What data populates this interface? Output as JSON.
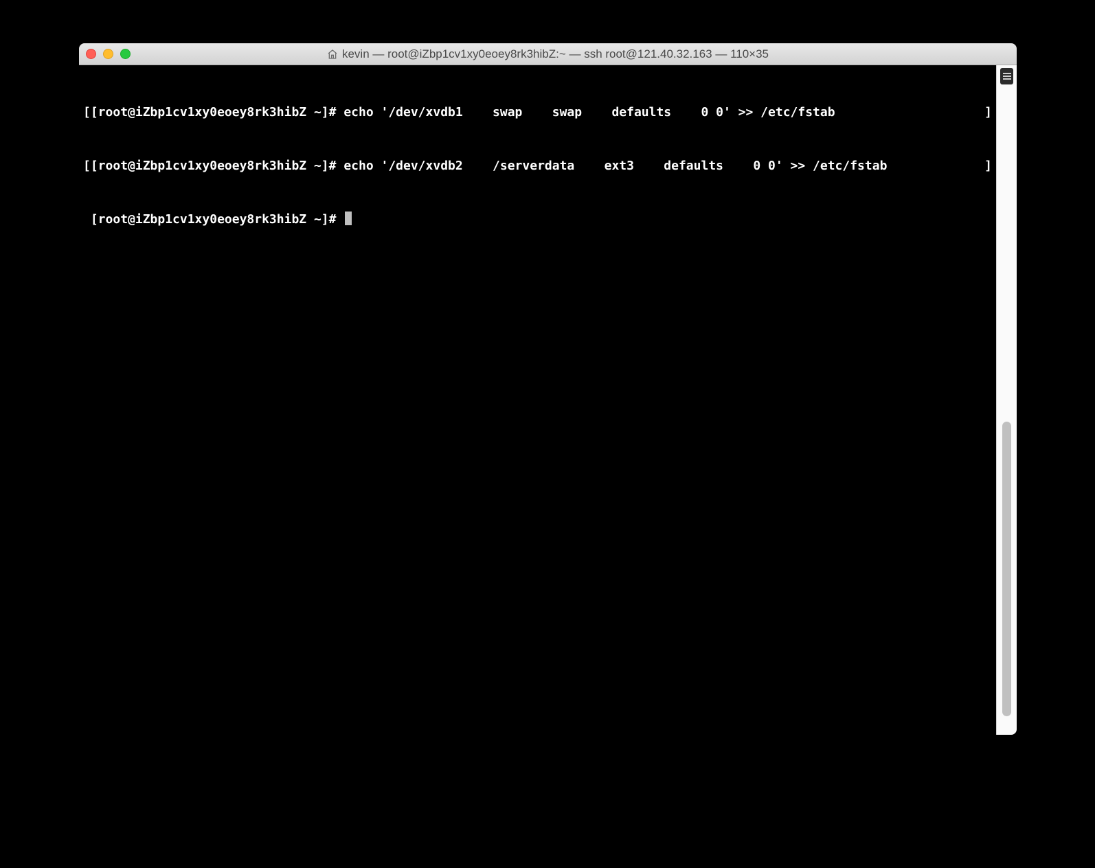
{
  "window": {
    "title": "kevin — root@iZbp1cv1xy0eoey8rk3hibZ:~ — ssh root@121.40.32.163 — 110×35"
  },
  "terminal": {
    "lines": [
      {
        "lbracket": "[",
        "prompt": "[root@iZbp1cv1xy0eoey8rk3hibZ ~]# ",
        "command": "echo '/dev/xvdb1    swap    swap    defaults    0 0' >> /etc/fstab",
        "rbracket": "]"
      },
      {
        "lbracket": "[",
        "prompt": "[root@iZbp1cv1xy0eoey8rk3hibZ ~]# ",
        "command": "echo '/dev/xvdb2    /serverdata    ext3    defaults    0 0' >> /etc/fstab",
        "rbracket": "]"
      },
      {
        "lbracket": " ",
        "prompt": "[root@iZbp1cv1xy0eoey8rk3hibZ ~]# ",
        "command": "",
        "rbracket": ""
      }
    ]
  }
}
